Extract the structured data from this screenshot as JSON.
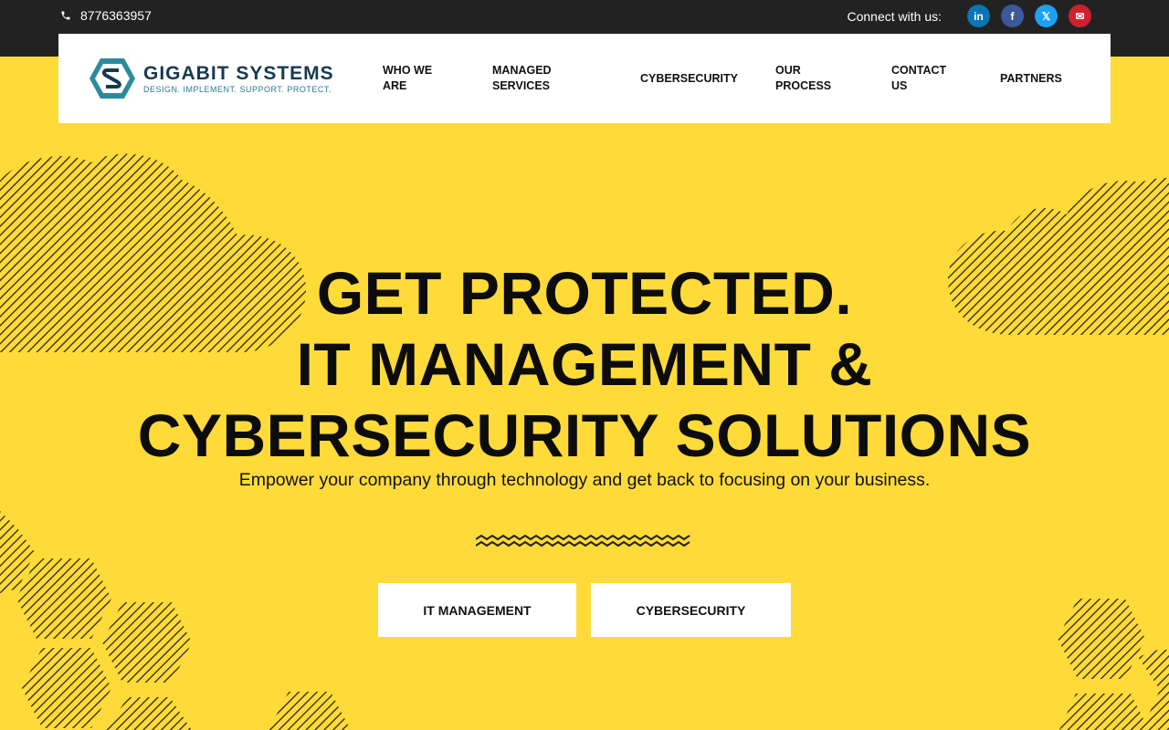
{
  "topbar": {
    "phone": "8776363957",
    "connect_label": "Connect with us:",
    "social": [
      {
        "icon": "linkedin-icon",
        "glyph": "in",
        "color": "#0a75b5"
      },
      {
        "icon": "facebook-icon",
        "glyph": "f",
        "color": "#3b5998"
      },
      {
        "icon": "x-twitter-icon",
        "glyph": "𝕏",
        "color": "#1da1f2"
      },
      {
        "icon": "email-icon",
        "glyph": "✉",
        "color": "#d0202f"
      }
    ]
  },
  "logo": {
    "brand": "GIGABIT SYSTEMS",
    "tagline": "DESIGN. IMPLEMENT. SUPPORT. PROTECT."
  },
  "nav": {
    "items": [
      {
        "label_1": "WHO WE",
        "label_2": "ARE"
      },
      {
        "label_1": "MANAGED",
        "label_2": "SERVICES"
      },
      {
        "label_1": "CYBERSECURITY",
        "label_2": ""
      },
      {
        "label_1": "OUR",
        "label_2": "PROCESS"
      },
      {
        "label_1": "CONTACT",
        "label_2": "US"
      },
      {
        "label_1": "PARTNERS",
        "label_2": ""
      }
    ]
  },
  "hero": {
    "line1": "GET PROTECTED.",
    "line2": "IT MANAGEMENT &",
    "line3": "CYBERSECURITY SOLUTIONS",
    "subtitle": "Empower your company through technology and get back to focusing on your business.",
    "buttons": [
      "IT MANAGEMENT",
      "CYBERSECURITY"
    ]
  },
  "colors": {
    "background": "#ffdb3a",
    "topbar": "#222222",
    "brand_dark": "#173a4e",
    "brand_teal": "#2c8a9c"
  }
}
